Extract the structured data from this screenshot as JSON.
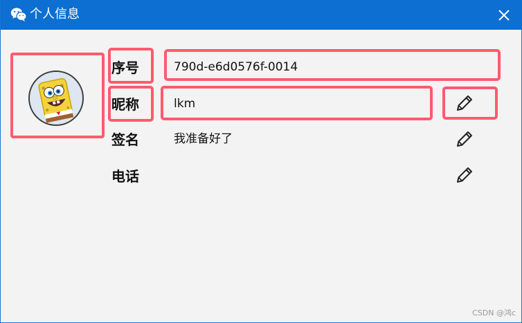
{
  "window": {
    "title": "个人信息",
    "app_icon": "wechat-icon",
    "close_icon": "close-icon"
  },
  "profile": {
    "avatar": "spongebob-avatar",
    "fields": [
      {
        "label": "序号",
        "value": "790d-e6d0576f-0014",
        "editable": false
      },
      {
        "label": "昵称",
        "value": "lkm",
        "editable": true
      },
      {
        "label": "签名",
        "value": "我准备好了",
        "editable": true
      },
      {
        "label": "电话",
        "value": "",
        "editable": true
      }
    ]
  },
  "edit_icon": "pencil-icon",
  "highlight_color": "#ff5a6e",
  "titlebar_color": "#0c6fd1",
  "watermark": "CSDN @鸿c"
}
